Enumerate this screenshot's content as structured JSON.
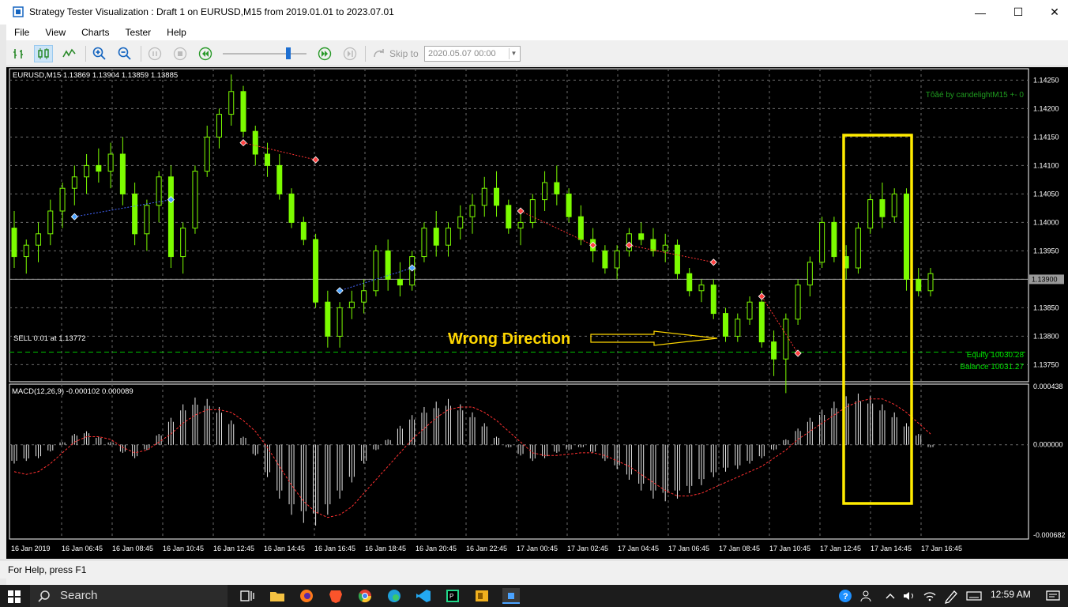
{
  "window": {
    "title": "Strategy Tester Visualization : Draft 1 on EURUSD,M15 from 2019.01.01 to 2023.07.01",
    "minimize": "—",
    "maximize": "☐",
    "close": "✕"
  },
  "menu": [
    "File",
    "View",
    "Charts",
    "Tester",
    "Help"
  ],
  "toolbar": {
    "skip_label": "Skip to",
    "skip_date": "2020.05.07 00:00",
    "slider_position": 0.78
  },
  "chart": {
    "header": "EURUSD,M15  1.13869 1.13904 1.13859 1.13885",
    "ea_label": "Tôâé by candelightM15 +- 0",
    "sell_label": "SELL 0.01 at 1.13772",
    "annotation": "Wrong Direction",
    "equity": "Equity 10030.28",
    "balance": "Balance 10031.27",
    "price_ticks": [
      "1.14250",
      "1.14200",
      "1.14150",
      "1.14100",
      "1.14050",
      "1.14000",
      "1.13950",
      "1.13900",
      "1.13850",
      "1.13800",
      "1.13750"
    ],
    "current_price": "1.13900",
    "macd_header": "MACD(12,26,9) -0.000102 0.000089",
    "macd_ticks": [
      "0.000438",
      "0.000000",
      "-0.000682"
    ],
    "time_ticks": [
      "16 Jan 2019",
      "16 Jan 06:45",
      "16 Jan 08:45",
      "16 Jan 10:45",
      "16 Jan 12:45",
      "16 Jan 14:45",
      "16 Jan 16:45",
      "16 Jan 18:45",
      "16 Jan 20:45",
      "16 Jan 22:45",
      "17 Jan 00:45",
      "17 Jan 02:45",
      "17 Jan 04:45",
      "17 Jan 06:45",
      "17 Jan 08:45",
      "17 Jan 10:45",
      "17 Jan 12:45",
      "17 Jan 14:45",
      "17 Jan 16:45"
    ],
    "colors": {
      "bull": "#c8ffc8",
      "bear": "#7cfc00",
      "grid": "#6b6b6b",
      "axis_text": "#ffffff",
      "macd_signal": "#ff3030",
      "highlight": "#ffeb00",
      "annotation": "#ffd700",
      "equity_text": "#00e000"
    },
    "candles": [
      [
        1.1399,
        1.1402,
        1.1392,
        1.1394
      ],
      [
        1.1394,
        1.1397,
        1.1391,
        1.1396
      ],
      [
        1.1396,
        1.14,
        1.1393,
        1.1398
      ],
      [
        1.1398,
        1.1404,
        1.1396,
        1.1402
      ],
      [
        1.1402,
        1.1407,
        1.1399,
        1.1406
      ],
      [
        1.1406,
        1.141,
        1.1403,
        1.1408
      ],
      [
        1.1408,
        1.1412,
        1.1405,
        1.141
      ],
      [
        1.141,
        1.1413,
        1.1407,
        1.1409
      ],
      [
        1.1409,
        1.1414,
        1.1406,
        1.1412
      ],
      [
        1.1412,
        1.1415,
        1.1403,
        1.1405
      ],
      [
        1.1405,
        1.1407,
        1.1396,
        1.1398
      ],
      [
        1.1398,
        1.1404,
        1.1395,
        1.1403
      ],
      [
        1.1403,
        1.1409,
        1.14,
        1.1408
      ],
      [
        1.1408,
        1.141,
        1.1392,
        1.1394
      ],
      [
        1.1394,
        1.14,
        1.1391,
        1.1399
      ],
      [
        1.1399,
        1.141,
        1.1398,
        1.1409
      ],
      [
        1.1409,
        1.1417,
        1.1408,
        1.1415
      ],
      [
        1.1415,
        1.142,
        1.1413,
        1.1419
      ],
      [
        1.1419,
        1.1426,
        1.1417,
        1.1423
      ],
      [
        1.1423,
        1.1424,
        1.1415,
        1.1416
      ],
      [
        1.1416,
        1.1417,
        1.141,
        1.1412
      ],
      [
        1.1412,
        1.1414,
        1.1408,
        1.141
      ],
      [
        1.141,
        1.1412,
        1.1404,
        1.1405
      ],
      [
        1.1405,
        1.1406,
        1.1399,
        1.14
      ],
      [
        1.14,
        1.1401,
        1.1396,
        1.1397
      ],
      [
        1.1397,
        1.1398,
        1.1385,
        1.1386
      ],
      [
        1.1386,
        1.1388,
        1.1378,
        1.138
      ],
      [
        1.138,
        1.1386,
        1.1378,
        1.1385
      ],
      [
        1.1385,
        1.1388,
        1.1383,
        1.1386
      ],
      [
        1.1386,
        1.139,
        1.1384,
        1.1388
      ],
      [
        1.1388,
        1.1396,
        1.1387,
        1.1395
      ],
      [
        1.1395,
        1.1397,
        1.1388,
        1.139
      ],
      [
        1.139,
        1.1393,
        1.1387,
        1.1389
      ],
      [
        1.1389,
        1.1395,
        1.1388,
        1.1394
      ],
      [
        1.1394,
        1.14,
        1.1393,
        1.1399
      ],
      [
        1.1399,
        1.1402,
        1.1394,
        1.1396
      ],
      [
        1.1396,
        1.14,
        1.1394,
        1.1399
      ],
      [
        1.1399,
        1.1403,
        1.1397,
        1.1401
      ],
      [
        1.1401,
        1.1405,
        1.1398,
        1.1403
      ],
      [
        1.1403,
        1.1408,
        1.1401,
        1.1406
      ],
      [
        1.1406,
        1.1409,
        1.1401,
        1.1403
      ],
      [
        1.1403,
        1.1404,
        1.1398,
        1.1399
      ],
      [
        1.1399,
        1.1402,
        1.1396,
        1.14
      ],
      [
        1.14,
        1.1405,
        1.1399,
        1.1404
      ],
      [
        1.1404,
        1.1409,
        1.1402,
        1.1407
      ],
      [
        1.1407,
        1.141,
        1.1403,
        1.1405
      ],
      [
        1.1405,
        1.1406,
        1.14,
        1.1401
      ],
      [
        1.1401,
        1.1403,
        1.1396,
        1.1397
      ],
      [
        1.1397,
        1.1399,
        1.1393,
        1.1395
      ],
      [
        1.1395,
        1.1396,
        1.1391,
        1.1392
      ],
      [
        1.1392,
        1.1396,
        1.139,
        1.1395
      ],
      [
        1.1395,
        1.1399,
        1.1394,
        1.1398
      ],
      [
        1.1398,
        1.14,
        1.1396,
        1.1397
      ],
      [
        1.1397,
        1.1399,
        1.1394,
        1.1395
      ],
      [
        1.1395,
        1.1398,
        1.1393,
        1.1396
      ],
      [
        1.1396,
        1.1397,
        1.139,
        1.1391
      ],
      [
        1.1391,
        1.1392,
        1.1387,
        1.1388
      ],
      [
        1.1388,
        1.139,
        1.1386,
        1.1389
      ],
      [
        1.1389,
        1.139,
        1.1383,
        1.1384
      ],
      [
        1.1384,
        1.1385,
        1.1379,
        1.138
      ],
      [
        1.138,
        1.1384,
        1.1379,
        1.1383
      ],
      [
        1.1383,
        1.1387,
        1.1382,
        1.1386
      ],
      [
        1.1386,
        1.1388,
        1.1378,
        1.1379
      ],
      [
        1.1379,
        1.1381,
        1.1373,
        1.1376
      ],
      [
        1.1376,
        1.1384,
        1.137,
        1.1383
      ],
      [
        1.1383,
        1.139,
        1.1382,
        1.1389
      ],
      [
        1.1389,
        1.1394,
        1.1387,
        1.1393
      ],
      [
        1.1393,
        1.1401,
        1.1392,
        1.14
      ],
      [
        1.14,
        1.1401,
        1.1393,
        1.1394
      ],
      [
        1.1394,
        1.1396,
        1.139,
        1.1392
      ],
      [
        1.1392,
        1.14,
        1.1391,
        1.1399
      ],
      [
        1.1399,
        1.1405,
        1.1398,
        1.1404
      ],
      [
        1.1404,
        1.1407,
        1.1399,
        1.1401
      ],
      [
        1.1401,
        1.1406,
        1.14,
        1.1405
      ],
      [
        1.1405,
        1.1406,
        1.1388,
        1.139
      ],
      [
        1.139,
        1.1392,
        1.1387,
        1.1388
      ],
      [
        1.1388,
        1.1392,
        1.1387,
        1.1391
      ]
    ],
    "macd_hist": [
      -0.00014,
      -0.00012,
      -0.0001,
      -5e-05,
      2e-05,
      8e-05,
      0.0001,
      6e-05,
      2e-05,
      -6e-05,
      -0.0001,
      -4e-05,
      8e-05,
      0.0002,
      0.0003,
      0.00035,
      0.00034,
      0.00028,
      0.00018,
      6e-05,
      -8e-05,
      -0.00024,
      -0.0004,
      -0.00052,
      -0.00058,
      -0.0006,
      -0.00052,
      -0.0004,
      -0.00028,
      -0.00014,
      -4e-05,
      4e-05,
      0.00014,
      0.00022,
      0.00028,
      0.00032,
      0.00034,
      0.0003,
      0.00024,
      0.00016,
      6e-05,
      -2e-05,
      -8e-05,
      -0.00012,
      -0.0001,
      -6e-05,
      -4e-05,
      -2e-05,
      -6e-05,
      -0.00012,
      -0.00018,
      -0.00026,
      -0.00034,
      -0.0004,
      -0.00042,
      -0.0004,
      -0.00036,
      -0.0003,
      -0.00024,
      -0.0002,
      -0.00018,
      -0.00014,
      -0.0001,
      -4e-05,
      4e-05,
      0.00012,
      0.0002,
      0.00026,
      0.00032,
      0.00036,
      0.00038,
      0.00036,
      0.0003,
      0.00024,
      0.00016,
      8e-05,
      -2e-05
    ],
    "macd_signal": [
      -0.0002,
      -0.00022,
      -0.0002,
      -0.00014,
      -6e-05,
      2e-05,
      6e-05,
      6e-05,
      4e-05,
      -2e-05,
      -6e-05,
      -4e-05,
      2e-05,
      8e-05,
      0.00016,
      0.00022,
      0.00026,
      0.00026,
      0.00024,
      0.00018,
      0.0001,
      -2e-05,
      -0.00016,
      -0.0003,
      -0.00042,
      -0.0005,
      -0.00054,
      -0.00052,
      -0.00046,
      -0.00036,
      -0.00026,
      -0.00016,
      -6e-05,
      4e-05,
      0.00012,
      0.0002,
      0.00026,
      0.00028,
      0.00028,
      0.00024,
      0.00018,
      0.0001,
      2e-05,
      -6e-05,
      -8e-05,
      -8e-05,
      -7e-05,
      -6e-05,
      -6e-05,
      -8e-05,
      -0.00012,
      -0.00016,
      -0.00022,
      -0.00028,
      -0.00034,
      -0.00038,
      -0.00038,
      -0.00036,
      -0.00032,
      -0.00028,
      -0.00024,
      -0.0002,
      -0.00016,
      -0.0001,
      -4e-05,
      4e-05,
      0.0001,
      0.00016,
      0.00022,
      0.00028,
      0.00032,
      0.00034,
      0.00034,
      0.0003,
      0.00024,
      0.00016,
      8e-05
    ]
  },
  "status": {
    "help": "For Help, press F1"
  },
  "taskbar": {
    "search": "Search",
    "time": "12:59 AM"
  }
}
